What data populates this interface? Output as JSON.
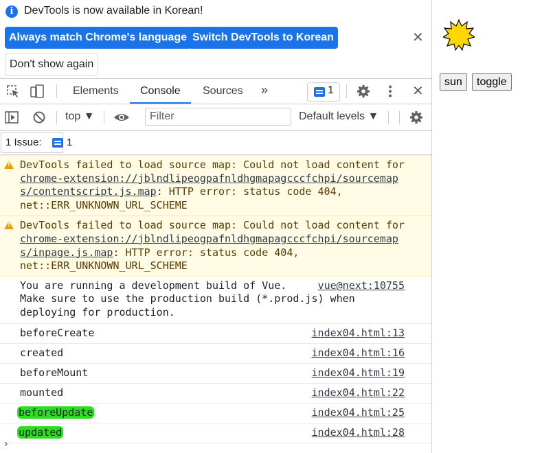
{
  "infobar": {
    "message": "DevTools is now available in Korean!",
    "match_language_label": "Always match Chrome's language",
    "switch_language_label": "Switch DevTools to Korean",
    "dont_show_label": "Don't show again",
    "close_glyph": "✕"
  },
  "tabs": {
    "elements": "Elements",
    "console": "Console",
    "sources": "Sources",
    "more_glyph": "»",
    "issues_count": "1",
    "close_glyph": "✕"
  },
  "console_toolbar": {
    "context": "top ▼",
    "filter_placeholder": "Filter",
    "levels": "Default levels ▼"
  },
  "issues_bar": {
    "label": "1 Issue:",
    "count": "1"
  },
  "messages": {
    "warn1": {
      "prefix": "DevTools failed to load source map: Could not load content for ",
      "url": "chrome-extension://jblndlipeogpafnldhgmapagcccfchpi/sourcemaps/contentscript.js.map",
      "suffix": ": HTTP error: status code 404, net::ERR_UNKNOWN_URL_SCHEME"
    },
    "warn2": {
      "prefix": "DevTools failed to load source map: Could not load content for ",
      "url": "chrome-extension://jblndlipeogpafnldhgmapagcccfchpi/sourcemaps/inpage.js.map",
      "suffix": ": HTTP error: status code 404, net::ERR_UNKNOWN_URL_SCHEME"
    },
    "vue": {
      "line1": "You are running a development build of Vue.",
      "line2": "Make sure to use the production build (*.prod.js) when",
      "line3": "deploying for production.",
      "source": "vue@next:10755"
    },
    "logs": [
      {
        "text": "beforeCreate",
        "source": "index04.html:13"
      },
      {
        "text": "created",
        "source": "index04.html:16"
      },
      {
        "text": "beforeMount",
        "source": "index04.html:19"
      },
      {
        "text": "mounted",
        "source": "index04.html:22"
      },
      {
        "text": "beforeUpdate",
        "source": "index04.html:25"
      },
      {
        "text": "updated",
        "source": "index04.html:28"
      }
    ],
    "prompt": "›"
  },
  "page": {
    "sun_button": "sun",
    "toggle_button": "toggle"
  },
  "colors": {
    "accent": "#1a73e8",
    "warning_bg": "#fffbe5",
    "highlight": "#2adf1f",
    "sun": "#ffd700"
  }
}
